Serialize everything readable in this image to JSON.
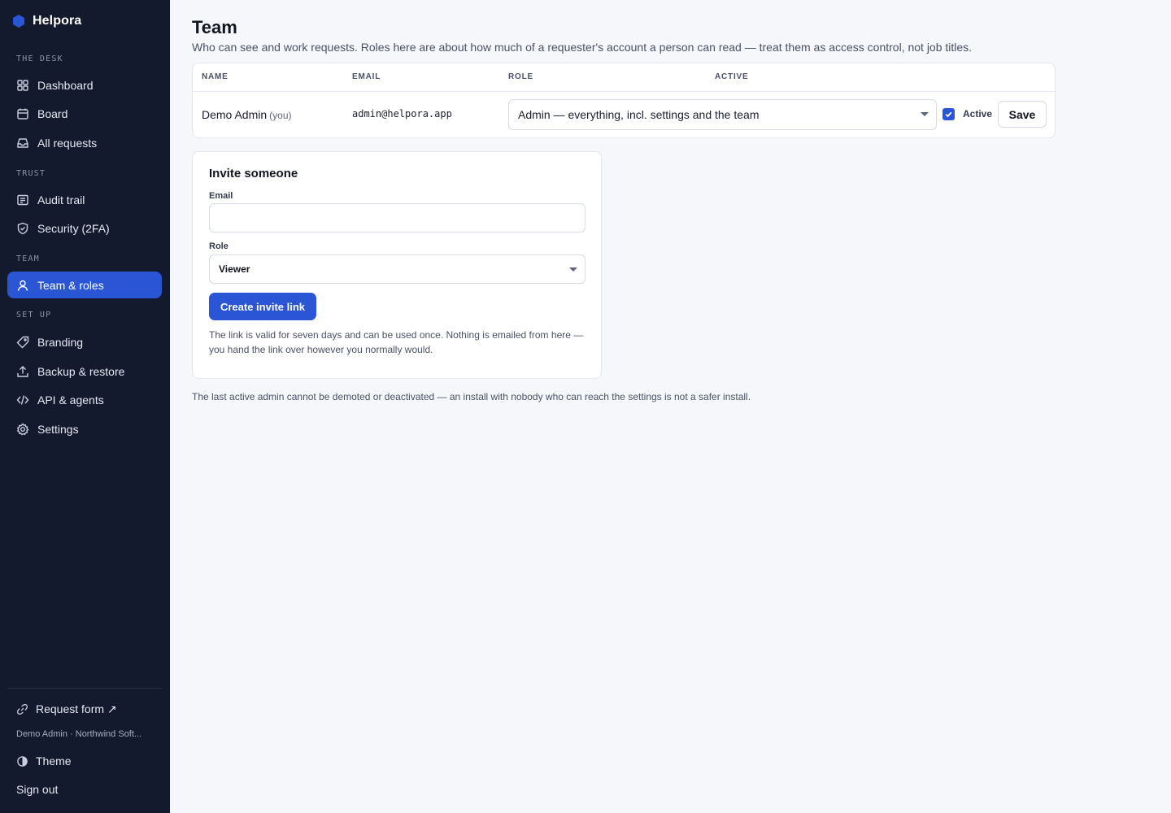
{
  "app": {
    "name": "Helpora"
  },
  "sidebar": {
    "sections": [
      {
        "label": "THE DESK",
        "items": [
          {
            "label": "Dashboard",
            "icon": "grid-icon"
          },
          {
            "label": "Board",
            "icon": "calendar-icon"
          },
          {
            "label": "All requests",
            "icon": "inbox-icon"
          }
        ]
      },
      {
        "label": "TRUST",
        "items": [
          {
            "label": "Audit trail",
            "icon": "list-icon"
          },
          {
            "label": "Security (2FA)",
            "icon": "shield-icon"
          }
        ]
      },
      {
        "label": "TEAM",
        "items": [
          {
            "label": "Team & roles",
            "icon": "user-icon",
            "active": true
          }
        ]
      },
      {
        "label": "SET UP",
        "items": [
          {
            "label": "Branding",
            "icon": "tag-icon"
          },
          {
            "label": "Backup & restore",
            "icon": "upload-icon"
          },
          {
            "label": "API & agents",
            "icon": "code-icon"
          },
          {
            "label": "Settings",
            "icon": "gear-icon"
          }
        ]
      }
    ],
    "footer": {
      "request_form": "Request form ↗",
      "user_line": "Demo Admin · Northwind Soft...",
      "theme": "Theme",
      "sign_out": "Sign out"
    }
  },
  "page": {
    "title": "Team",
    "subtitle": "Who can see and work requests. Roles here are about how much of a requester's account a person can read — treat them as access control, not job titles."
  },
  "team_table": {
    "headers": {
      "name": "NAME",
      "email": "EMAIL",
      "role": "ROLE",
      "active": "ACTIVE"
    },
    "rows": [
      {
        "name": "Demo Admin",
        "you_tag": "(you)",
        "email": "admin@helpora.app",
        "role": "Admin — everything, incl. settings and the team",
        "active": true,
        "active_label": "Active",
        "save_label": "Save"
      }
    ]
  },
  "invite": {
    "title": "Invite someone",
    "email_label": "Email",
    "email_value": "",
    "role_label": "Role",
    "role_value": "Viewer",
    "button_label": "Create invite link",
    "note": "The link is valid for seven days and can be used once. Nothing is emailed from here — you hand the link over however you normally would."
  },
  "footnote": "The last active admin cannot be demoted or deactivated — an install with nobody who can reach the settings is not a safer install.",
  "colors": {
    "sidebar_bg": "#141a2e",
    "accent": "#2a56d6",
    "page_bg": "#f5f7fb"
  }
}
